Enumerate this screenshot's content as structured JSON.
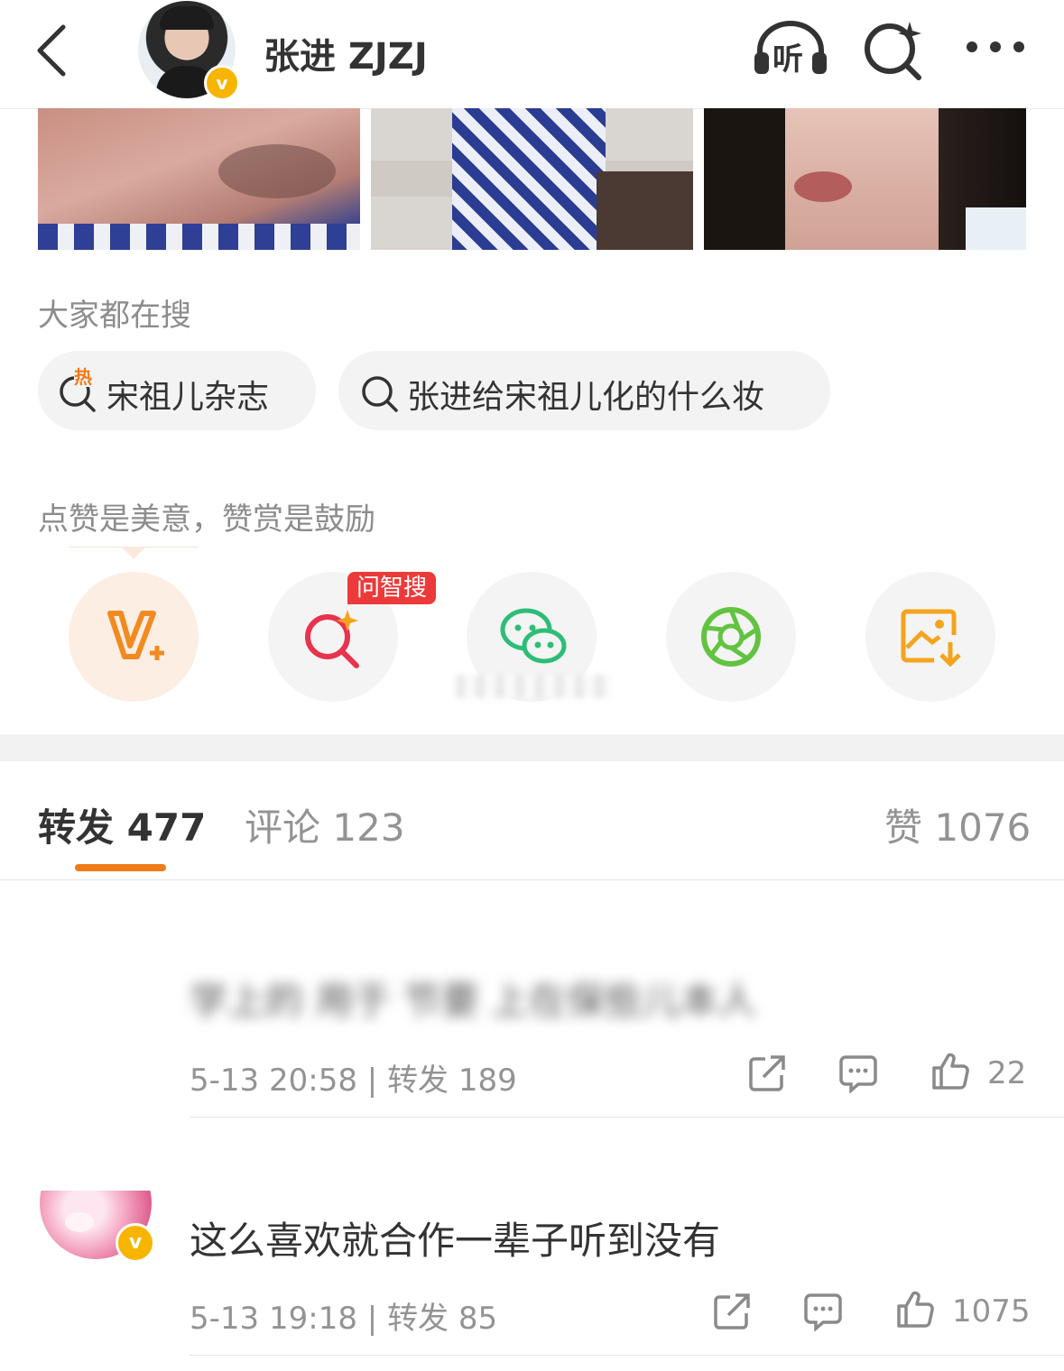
{
  "header": {
    "back_icon": "chevron-left-icon",
    "username": "张进 ZJZJ",
    "verified_badge": "v",
    "listen_label": "听",
    "colors": {
      "badge": "#f7b500"
    }
  },
  "hot_search": {
    "section_title": "大家都在搜",
    "hot_tag": "热",
    "chips": [
      {
        "text": "宋祖儿杂志"
      },
      {
        "text": "张进给宋祖儿化的什么妆"
      }
    ]
  },
  "reward": {
    "prompt": "点赞是美意，赞赏是鼓励",
    "ask_tag": "问智搜"
  },
  "tabs": {
    "repost": {
      "label": "转发",
      "count": "477"
    },
    "comment": {
      "label": "评论",
      "count": "123"
    },
    "like": {
      "label": "赞",
      "count": "1076"
    },
    "accent": "#f07b19"
  },
  "reposts": [
    {
      "text": "学上的 用于 节要 上在保些儿本人",
      "time": "5-13 20:58",
      "repost_label": "转发 189",
      "likes": "22"
    },
    {
      "text": "这么喜欢就合作一辈子听到没有",
      "time": "5-13 19:18",
      "repost_label": "转发 85",
      "likes": "1075",
      "verified_badge": "v"
    }
  ],
  "separator": "|"
}
